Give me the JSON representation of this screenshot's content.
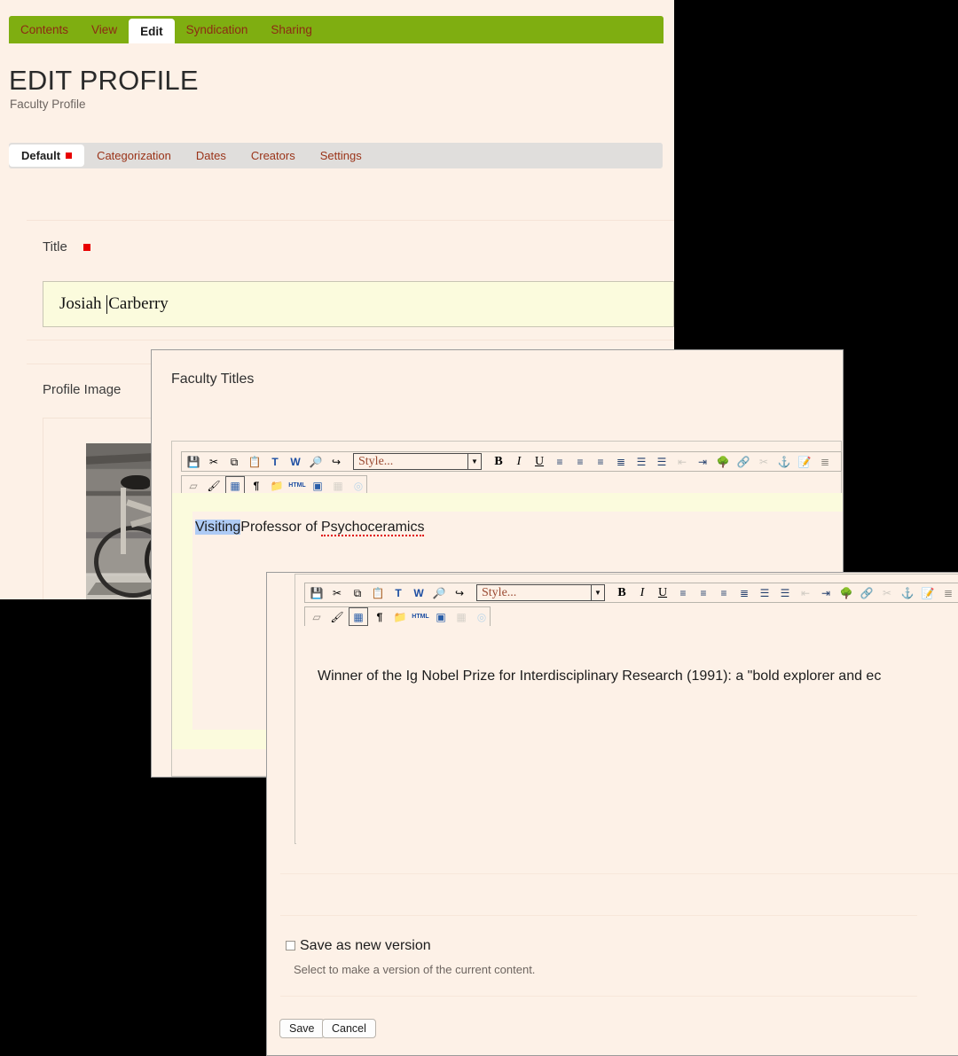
{
  "page": {
    "content_tabs": [
      {
        "label": "Contents",
        "selected": false
      },
      {
        "label": "View",
        "selected": false
      },
      {
        "label": "Edit",
        "selected": true
      },
      {
        "label": "Syndication",
        "selected": false
      },
      {
        "label": "Sharing",
        "selected": false
      }
    ],
    "title": "EDIT PROFILE",
    "description": "Faculty Profile",
    "form_tabs": [
      {
        "label": "Default",
        "selected": true,
        "required": true
      },
      {
        "label": "Categorization",
        "selected": false,
        "required": false
      },
      {
        "label": "Dates",
        "selected": false,
        "required": false
      },
      {
        "label": "Creators",
        "selected": false,
        "required": false
      },
      {
        "label": "Settings",
        "selected": false,
        "required": false
      }
    ],
    "fields": {
      "title_label": "Title",
      "title_value": "Josiah Carberry",
      "title_required": true,
      "profile_image_label": "Profile Image",
      "profile_image_alt": "black and white photograph of a bicycle leaning against a wooden wall"
    }
  },
  "dialog_titles": {
    "title": "Faculty Titles",
    "content": "Visiting Professor of Psychoceramics",
    "content_selected": "Visiting",
    "content_rest": "Professor of ",
    "content_misspelled": "Psychoceramics"
  },
  "dialog_bio": {
    "content": "Winner of the Ig Nobel Prize for Interdisciplinary Research (1991): a \"bold explorer and ec",
    "save_as_new_version_label": "Save as new version",
    "save_as_new_version_help": "Select to make a version of the current content.",
    "save_as_new_version_checked": false,
    "save_label": "Save",
    "cancel_label": "Cancel"
  },
  "toolbar": {
    "style_placeholder": "Style...",
    "row1": [
      {
        "name": "save-icon",
        "glyph": "💾",
        "enabled": true
      },
      {
        "name": "cut-icon",
        "glyph": "✂",
        "enabled": true
      },
      {
        "name": "copy-icon",
        "glyph": "⧉",
        "enabled": true
      },
      {
        "name": "paste-icon",
        "glyph": "📋",
        "enabled": true
      },
      {
        "name": "paste-as-plain-text-icon",
        "glyph": "T",
        "enabled": true
      },
      {
        "name": "paste-from-word-icon",
        "glyph": "W",
        "enabled": true
      },
      {
        "name": "find-icon",
        "glyph": "🔎",
        "enabled": true
      },
      {
        "name": "replace-icon",
        "glyph": "↪",
        "enabled": true
      }
    ],
    "row1b": [
      {
        "name": "bold-icon",
        "glyph": "B",
        "enabled": true
      },
      {
        "name": "italic-icon",
        "glyph": "I",
        "enabled": true
      },
      {
        "name": "underline-icon",
        "glyph": "U",
        "enabled": true
      },
      {
        "name": "align-left-icon",
        "glyph": "≡",
        "enabled": true
      },
      {
        "name": "align-center-icon",
        "glyph": "≡",
        "enabled": true
      },
      {
        "name": "align-right-icon",
        "glyph": "≡",
        "enabled": true
      },
      {
        "name": "justify-icon",
        "glyph": "≡",
        "enabled": true
      },
      {
        "name": "bulleted-list-icon",
        "glyph": "☰",
        "enabled": true
      },
      {
        "name": "numbered-list-icon",
        "glyph": "☰",
        "enabled": true
      },
      {
        "name": "outdent-icon",
        "glyph": "⇤",
        "enabled": false
      },
      {
        "name": "indent-icon",
        "glyph": "⇥",
        "enabled": true
      },
      {
        "name": "insert-image-icon",
        "glyph": "🌳",
        "enabled": true
      },
      {
        "name": "insert-link-icon",
        "glyph": "🔗",
        "enabled": false
      },
      {
        "name": "unlink-icon",
        "glyph": "✂",
        "enabled": false
      },
      {
        "name": "anchor-icon",
        "glyph": "⚓",
        "enabled": true
      },
      {
        "name": "edit-table-icon",
        "glyph": "✎",
        "enabled": true
      },
      {
        "name": "definition-list-icon",
        "glyph": "≣",
        "enabled": true
      }
    ],
    "row2": [
      {
        "name": "remove-format-icon",
        "glyph": "▱",
        "enabled": true
      },
      {
        "name": "clean-formatting-icon",
        "glyph": "🖌",
        "enabled": true
      },
      {
        "name": "insert-table-icon",
        "glyph": "▦",
        "enabled": true,
        "active": true
      },
      {
        "name": "show-paragraphs-icon",
        "glyph": "¶",
        "enabled": true
      },
      {
        "name": "insert-template-icon",
        "glyph": "📁",
        "enabled": true
      },
      {
        "name": "html-source-icon",
        "glyph": "HTML",
        "enabled": true
      },
      {
        "name": "fullscreen-icon",
        "glyph": "▣",
        "enabled": true
      },
      {
        "name": "delete-table-icon",
        "glyph": "▦",
        "enabled": false
      },
      {
        "name": "spellcheck-icon",
        "glyph": "◎",
        "enabled": false
      }
    ]
  },
  "colors": {
    "brand_green": "#7fae11",
    "link_red": "#8c2b14",
    "required_red": "#e80000",
    "page_bg": "#fdf1e7",
    "input_yellow": "#fbfbdd",
    "selection_blue": "#aecbf5"
  }
}
